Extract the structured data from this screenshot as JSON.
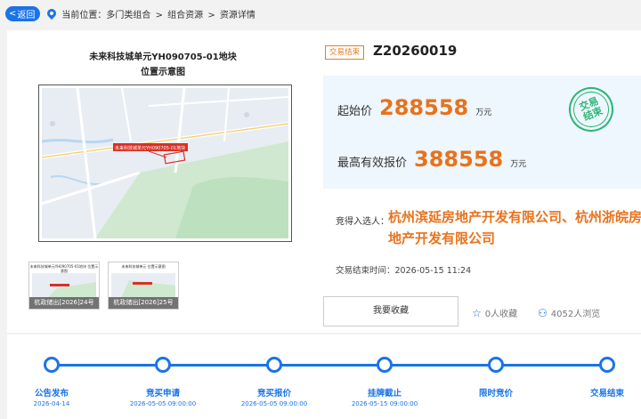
{
  "nav": {
    "back_label": "返回",
    "location_prefix": "当前位置：",
    "crumbs": [
      "多门类组合",
      ">",
      "组合资源",
      ">",
      "资源详情"
    ]
  },
  "map": {
    "title_line1": "未来科技城单元YH090705-01地块",
    "title_line2": "位置示意图",
    "parcel_tag": "未来科技城单元YH090705-01地块"
  },
  "thumbnails": [
    {
      "caption": "杭政储出[2026]24号",
      "title": "未来科技城单元YH090705-01地块 位置示意图"
    },
    {
      "caption": "杭政储出[2026]25号",
      "title": "未来科技城单元 位置示意图"
    }
  ],
  "listing": {
    "status": "交易结束",
    "code": "Z20260019",
    "start_price_label": "起始价",
    "start_price": "288558",
    "start_price_unit": "万元",
    "top_price_label": "最高有效报价",
    "top_price": "388558",
    "top_price_unit": "万元",
    "stamp_text": "交易结束",
    "winner_label": "竞得入选人：",
    "winner": "杭州滨延房地产开发有限公司、杭州浙皖房地产开发有限公司",
    "end_time_label": "交易结束时间：",
    "end_time": "2026-05-15 11:24"
  },
  "actions": {
    "favorite_button": "我要收藏",
    "favorites_count": "0人收藏",
    "views_count": "4052人浏览"
  },
  "timeline": [
    {
      "label": "公告发布",
      "date": "2026-04-14"
    },
    {
      "label": "竞买申请",
      "date": "2026-05-05 09:00:00"
    },
    {
      "label": "竞买报价",
      "date": "2026-05-05 09:00:00"
    },
    {
      "label": "挂牌截止",
      "date": "2026-05-15 09:00:00"
    },
    {
      "label": "限时竞价",
      "date": ""
    },
    {
      "label": "交易结束",
      "date": ""
    }
  ],
  "colors": {
    "accent": "#1a73e8",
    "price": "#e8721c",
    "stamp": "#2bb673",
    "status": "#e67e22"
  }
}
